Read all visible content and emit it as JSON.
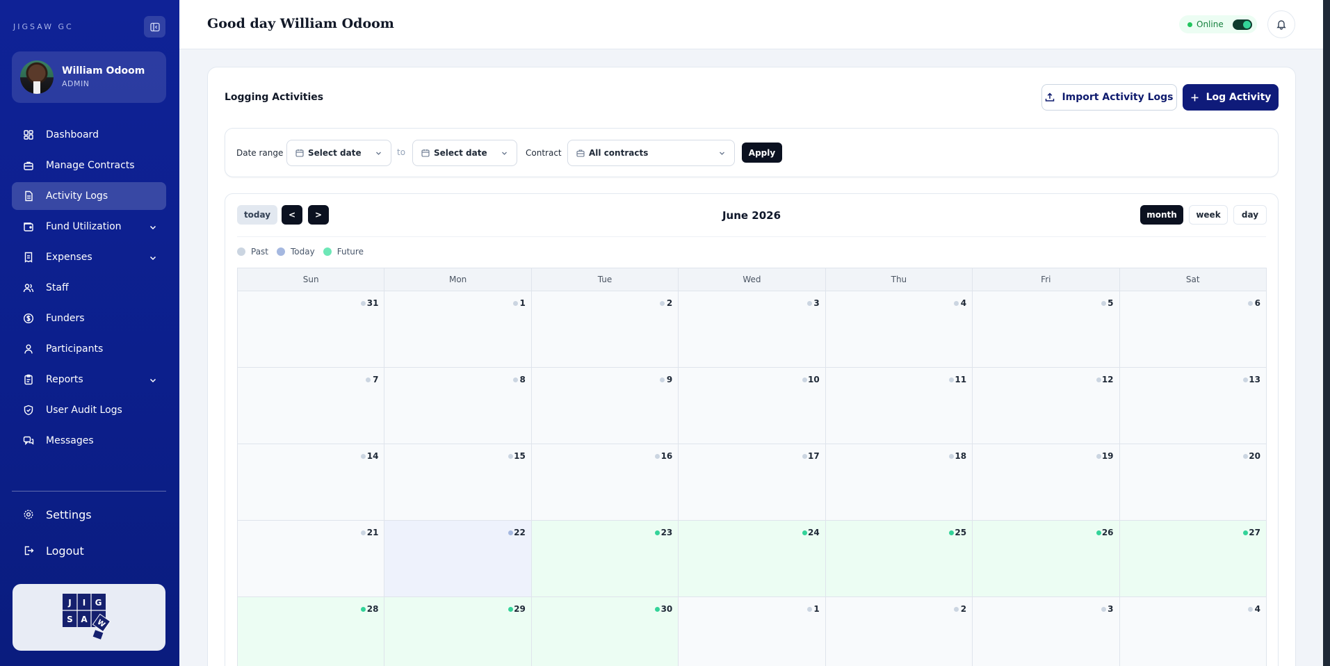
{
  "sidebar": {
    "brand": "JIGSAW GC",
    "profile": {
      "name": "William Odoom",
      "role": "ADMIN"
    },
    "items": [
      {
        "label": "Dashboard",
        "icon": "dashboard-icon"
      },
      {
        "label": "Manage Contracts",
        "icon": "briefcase-icon"
      },
      {
        "label": "Activity Logs",
        "icon": "document-icon",
        "active": true
      },
      {
        "label": "Fund Utilization",
        "icon": "wallet-icon",
        "expandable": true
      },
      {
        "label": "Expenses",
        "icon": "receipt-icon",
        "expandable": true
      },
      {
        "label": "Staff",
        "icon": "users-icon"
      },
      {
        "label": "Funders",
        "icon": "dollar-icon"
      },
      {
        "label": "Participants",
        "icon": "user-icon"
      },
      {
        "label": "Reports",
        "icon": "clipboard-icon",
        "expandable": true
      },
      {
        "label": "User Audit Logs",
        "icon": "shield-icon"
      },
      {
        "label": "Messages",
        "icon": "message-icon"
      }
    ],
    "settings_label": "Settings",
    "logout_label": "Logout",
    "logo_letters": [
      "J",
      "I",
      "G",
      "S",
      "A",
      "W"
    ]
  },
  "header": {
    "greeting": "Good day William Odoom",
    "status_label": "Online"
  },
  "main": {
    "title": "Logging Activities",
    "import_label": "Import Activity Logs",
    "log_label": "Log Activity",
    "filters": {
      "date_range_label": "Date range",
      "start_placeholder": "Select date",
      "to_label": "to",
      "end_placeholder": "Select date",
      "contract_label": "Contract",
      "contract_value": "All contracts",
      "apply_label": "Apply"
    },
    "calendar": {
      "today_label": "today",
      "prev_label": "<",
      "next_label": ">",
      "title": "June 2026",
      "views": [
        "month",
        "week",
        "day"
      ],
      "active_view": "month",
      "legend": [
        {
          "label": "Past",
          "color": "#cbd5e1"
        },
        {
          "label": "Today",
          "color": "#a5b8e0"
        },
        {
          "label": "Future",
          "color": "#6ee7b7"
        }
      ],
      "weekdays": [
        "Sun",
        "Mon",
        "Tue",
        "Wed",
        "Thu",
        "Fri",
        "Sat"
      ],
      "weeks": [
        [
          31,
          1,
          2,
          3,
          4,
          5,
          6
        ],
        [
          7,
          8,
          9,
          10,
          11,
          12,
          13
        ],
        [
          14,
          15,
          16,
          17,
          18,
          19,
          20
        ],
        [
          21,
          22,
          23,
          24,
          25,
          26,
          27
        ],
        [
          28,
          29,
          30,
          1,
          2,
          3,
          4
        ]
      ],
      "states": [
        [
          "past",
          "past",
          "past",
          "past",
          "past",
          "past",
          "past"
        ],
        [
          "past",
          "past",
          "past",
          "past",
          "past",
          "past",
          "past"
        ],
        [
          "past",
          "past",
          "past",
          "past",
          "past",
          "past",
          "past"
        ],
        [
          "past",
          "today",
          "future",
          "future",
          "future",
          "future",
          "future"
        ],
        [
          "future",
          "future",
          "future",
          "past",
          "past",
          "past",
          "past"
        ]
      ],
      "colors": {
        "past_dot": "#cbd5e1",
        "today_dot": "#a5b8e0",
        "future_dot": "#34d399"
      }
    }
  }
}
